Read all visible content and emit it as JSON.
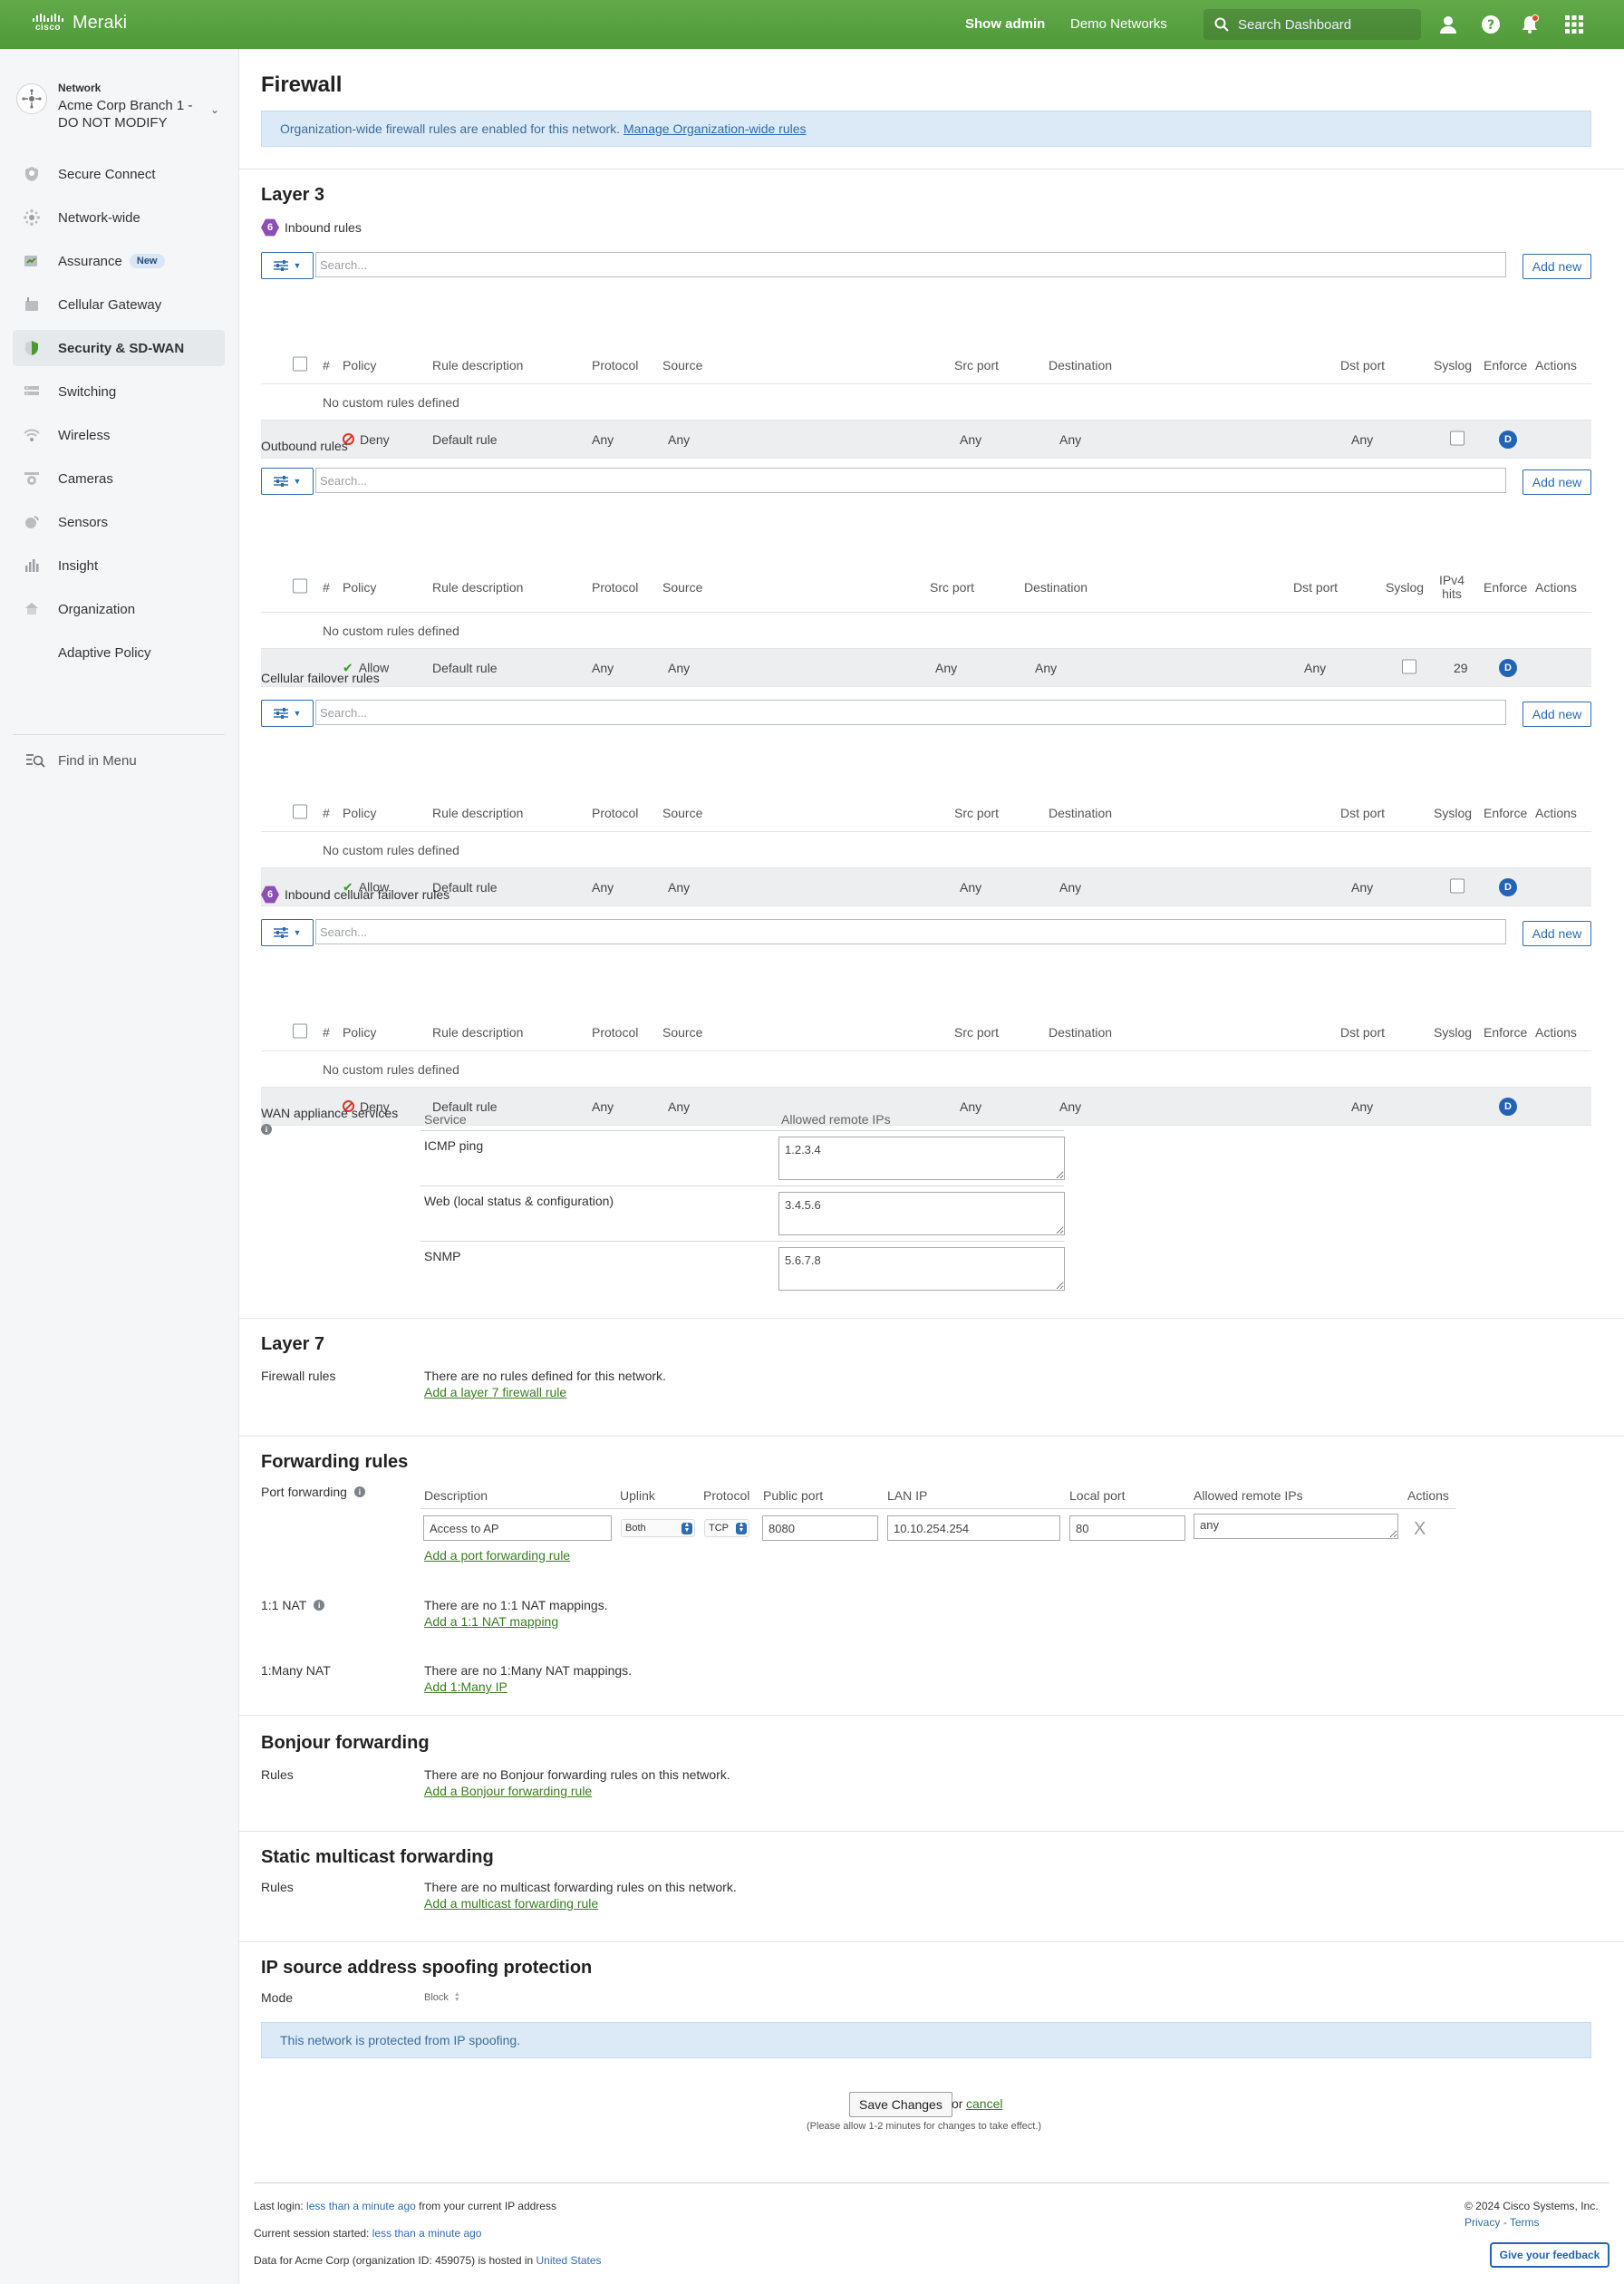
{
  "topbar": {
    "brand_cisco": "cisco",
    "brand_meraki": "Meraki",
    "show_admin": "Show admin",
    "demo_networks": "Demo Networks",
    "search_placeholder": "Search Dashboard"
  },
  "sidebar": {
    "network_label": "Network",
    "network_name": "Acme Corp Branch 1 - DO NOT MODIFY",
    "items": [
      {
        "label": "Secure Connect",
        "icon": "secure-connect-icon"
      },
      {
        "label": "Network-wide",
        "icon": "network-wide-icon"
      },
      {
        "label": "Assurance",
        "icon": "assurance-icon",
        "badge": "New"
      },
      {
        "label": "Cellular Gateway",
        "icon": "cellular-gateway-icon"
      },
      {
        "label": "Security & SD-WAN",
        "icon": "security-shield-icon",
        "active": true
      },
      {
        "label": "Switching",
        "icon": "switching-icon"
      },
      {
        "label": "Wireless",
        "icon": "wireless-icon"
      },
      {
        "label": "Cameras",
        "icon": "camera-icon"
      },
      {
        "label": "Sensors",
        "icon": "sensors-icon"
      },
      {
        "label": "Insight",
        "icon": "insight-icon"
      },
      {
        "label": "Organization",
        "icon": "organization-icon"
      },
      {
        "label": "Adaptive Policy",
        "icon": ""
      }
    ],
    "find_in_menu": "Find in Menu"
  },
  "page": {
    "title": "Firewall",
    "org_banner_text": "Organization-wide firewall rules are enabled for this network.",
    "org_banner_link": "Manage Organization-wide rules"
  },
  "layer3": {
    "title": "Layer 3",
    "search_placeholder": "Search...",
    "add_new": "Add new",
    "hex_number": "6",
    "no_rules": "No custom rules defined",
    "headers": {
      "num": "#",
      "policy": "Policy",
      "desc": "Rule description",
      "protocol": "Protocol",
      "source": "Source",
      "src_port": "Src port",
      "destination": "Destination",
      "dst_port": "Dst port",
      "syslog": "Syslog",
      "hits_line1": "IPv4",
      "hits_line2": "hits",
      "enforce": "Enforce",
      "actions": "Actions"
    },
    "inbound": {
      "title": "Inbound rules",
      "default_row": {
        "policy": "Deny",
        "desc": "Default rule",
        "protocol": "Any",
        "source": "Any",
        "src_port": "Any",
        "destination": "Any",
        "dst_port": "Any",
        "enforce": "D"
      }
    },
    "outbound": {
      "title": "Outbound rules",
      "default_row": {
        "policy": "Allow",
        "desc": "Default rule",
        "protocol": "Any",
        "source": "Any",
        "src_port": "Any",
        "destination": "Any",
        "dst_port": "Any",
        "hits": "29",
        "enforce": "D"
      }
    },
    "cellular": {
      "title": "Cellular failover rules",
      "default_row": {
        "policy": "Allow",
        "desc": "Default rule",
        "protocol": "Any",
        "source": "Any",
        "src_port": "Any",
        "destination": "Any",
        "dst_port": "Any",
        "enforce": "D"
      }
    },
    "inbound_cellular": {
      "title": "Inbound cellular failover rules",
      "default_row": {
        "policy": "Deny",
        "desc": "Default rule",
        "protocol": "Any",
        "source": "Any",
        "src_port": "Any",
        "destination": "Any",
        "dst_port": "Any",
        "enforce": "D"
      }
    }
  },
  "wan": {
    "label": "WAN appliance services",
    "col_service": "Service",
    "col_ips": "Allowed remote IPs",
    "rows": [
      {
        "service": "ICMP ping",
        "ips": "1.2.3.4"
      },
      {
        "service": "Web (local status & configuration)",
        "ips": "3.4.5.6"
      },
      {
        "service": "SNMP",
        "ips": "5.6.7.8"
      }
    ]
  },
  "layer7": {
    "title": "Layer 7",
    "label": "Firewall rules",
    "text": "There are no rules defined for this network.",
    "link": "Add a layer 7 firewall rule"
  },
  "forwarding": {
    "title": "Forwarding rules",
    "port_label": "Port forwarding",
    "headers": {
      "description": "Description",
      "uplink": "Uplink",
      "protocol": "Protocol",
      "public_port": "Public port",
      "lan_ip": "LAN IP",
      "local_port": "Local port",
      "allowed_ips": "Allowed remote IPs",
      "actions": "Actions"
    },
    "row": {
      "description": "Access to AP",
      "uplink": "Both",
      "protocol": "TCP",
      "public_port": "8080",
      "lan_ip": "10.10.254.254",
      "local_port": "80",
      "allowed_ips": "any",
      "remove": "X"
    },
    "add_port_link": "Add a port forwarding rule",
    "nat11_label": "1:1 NAT",
    "nat11_text": "There are no 1:1 NAT mappings.",
    "nat11_link": "Add a 1:1 NAT mapping",
    "natmany_label": "1:Many NAT",
    "natmany_text": "There are no 1:Many NAT mappings.",
    "natmany_link": "Add 1:Many IP"
  },
  "bonjour": {
    "title": "Bonjour forwarding",
    "label": "Rules",
    "text": "There are no Bonjour forwarding rules on this network.",
    "link": "Add a Bonjour forwarding rule"
  },
  "multicast": {
    "title": "Static multicast forwarding",
    "label": "Rules",
    "text": "There are no multicast forwarding rules on this network.",
    "link": "Add a multicast forwarding rule"
  },
  "spoofing": {
    "title": "IP source address spoofing protection",
    "mode_label": "Mode",
    "mode_value": "Block",
    "banner": "This network is protected from IP spoofing."
  },
  "actions": {
    "save": "Save Changes",
    "or": "or",
    "cancel": "cancel",
    "note": "(Please allow 1-2 minutes for changes to take effect.)"
  },
  "footer": {
    "last_login_prefix": "Last login:",
    "last_login_value": "less than a minute ago",
    "last_login_suffix": "from your current IP address",
    "session_prefix": "Current session started:",
    "session_value": "less than a minute ago",
    "hosted_prefix": "Data for Acme Corp (organization ID: 459075) is hosted in",
    "hosted_value": "United States",
    "copyright": "© 2024 Cisco Systems, Inc.",
    "privacy": "Privacy",
    "dash": "-",
    "terms": "Terms",
    "feedback": "Give your feedback"
  }
}
